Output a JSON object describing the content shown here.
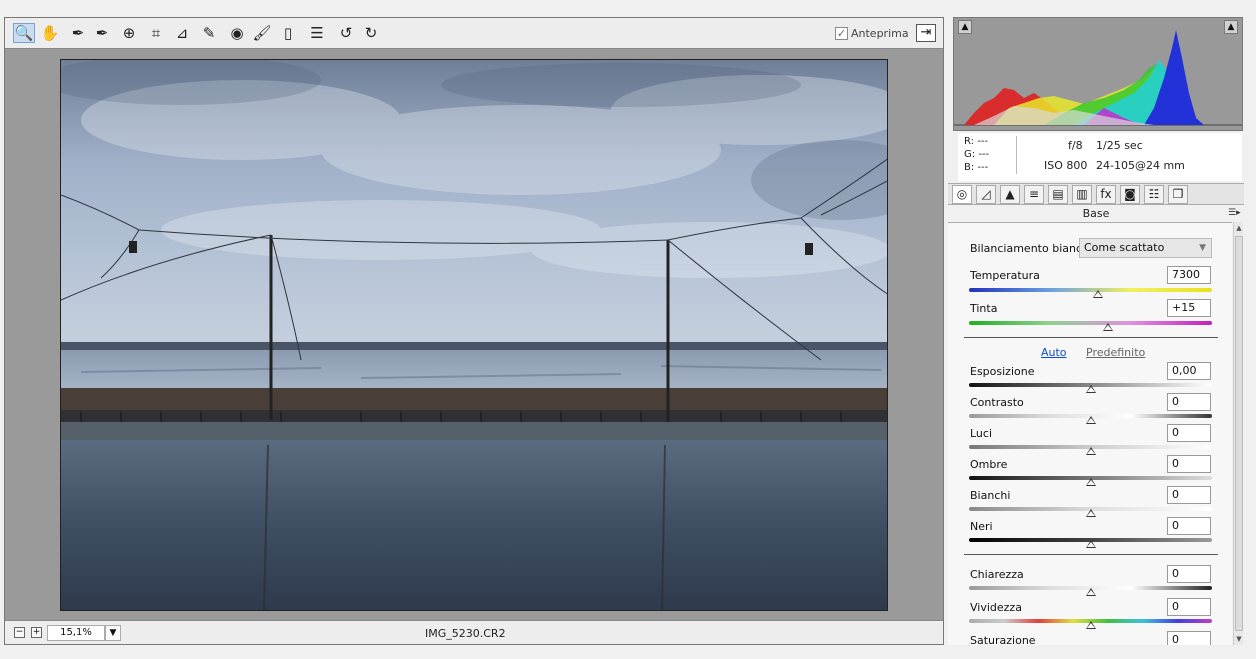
{
  "toolbar": {
    "tools": [
      {
        "icon": "zoom-tool-icon",
        "glyph": "🔍",
        "active": true
      },
      {
        "icon": "hand-tool-icon",
        "glyph": "✋"
      },
      {
        "icon": "white-balance-tool-icon",
        "glyph": "✒"
      },
      {
        "icon": "color-sampler-tool-icon",
        "glyph": "✒"
      },
      {
        "icon": "targeted-adjustment-tool-icon",
        "glyph": "⊕"
      },
      {
        "icon": "crop-tool-icon",
        "glyph": "⌗"
      },
      {
        "icon": "straighten-tool-icon",
        "glyph": "⊿"
      },
      {
        "icon": "spot-removal-tool-icon",
        "glyph": "✎"
      },
      {
        "icon": "red-eye-tool-icon",
        "glyph": "◉"
      },
      {
        "icon": "adjustment-brush-icon",
        "glyph": "🖌"
      },
      {
        "icon": "graduated-filter-icon",
        "glyph": "▯"
      },
      {
        "icon": "preferences-list-icon",
        "glyph": "☰"
      },
      {
        "icon": "rotate-left-icon",
        "glyph": "↺"
      },
      {
        "icon": "rotate-right-icon",
        "glyph": "↻"
      }
    ],
    "preview_label": "Anteprima",
    "preview_checked": true
  },
  "statusbar": {
    "zoom_value": "15,1%",
    "filename": "IMG_5230.CR2"
  },
  "info": {
    "r_label": "R:",
    "r_value": "---",
    "g_label": "G:",
    "g_value": "---",
    "b_label": "B:",
    "b_value": "---",
    "aperture": "f/8",
    "shutter": "1/25 sec",
    "iso": "ISO 800",
    "lens": "24-105@24 mm"
  },
  "panel": {
    "title": "Base",
    "tabs": [
      {
        "icon": "basic-tab-icon",
        "glyph": "◎",
        "active": true
      },
      {
        "icon": "tone-curve-tab-icon",
        "glyph": "◿"
      },
      {
        "icon": "detail-tab-icon",
        "glyph": "▲"
      },
      {
        "icon": "hsl-tab-icon",
        "glyph": "≡"
      },
      {
        "icon": "split-toning-tab-icon",
        "glyph": "▤"
      },
      {
        "icon": "lens-corrections-tab-icon",
        "glyph": "▥"
      },
      {
        "icon": "effects-tab-icon",
        "glyph": "fx"
      },
      {
        "icon": "camera-calibration-tab-icon",
        "glyph": "◙"
      },
      {
        "icon": "presets-tab-icon",
        "glyph": "☷"
      },
      {
        "icon": "snapshots-tab-icon",
        "glyph": "❐"
      }
    ],
    "white_balance_label": "Bilanciamento bianco:",
    "white_balance_value": "Come scattato",
    "auto_label": "Auto",
    "default_label": "Predefinito",
    "sliders": {
      "temperature": {
        "label": "Temperatura",
        "value": "7300",
        "level": 0.53
      },
      "tint": {
        "label": "Tinta",
        "value": "+15",
        "level": 0.57
      },
      "exposure": {
        "label": "Esposizione",
        "value": "0,00",
        "level": 0.5
      },
      "contrast": {
        "label": "Contrasto",
        "value": "0",
        "level": 0.5
      },
      "highlights": {
        "label": "Luci",
        "value": "0",
        "level": 0.5
      },
      "shadows": {
        "label": "Ombre",
        "value": "0",
        "level": 0.5
      },
      "whites": {
        "label": "Bianchi",
        "value": "0",
        "level": 0.5
      },
      "blacks": {
        "label": "Neri",
        "value": "0",
        "level": 0.5
      },
      "clarity": {
        "label": "Chiarezza",
        "value": "0",
        "level": 0.5
      },
      "vibrance": {
        "label": "Vividezza",
        "value": "0",
        "level": 0.5
      },
      "saturation": {
        "label": "Saturazione",
        "value": "0",
        "level": 0.5
      }
    }
  }
}
